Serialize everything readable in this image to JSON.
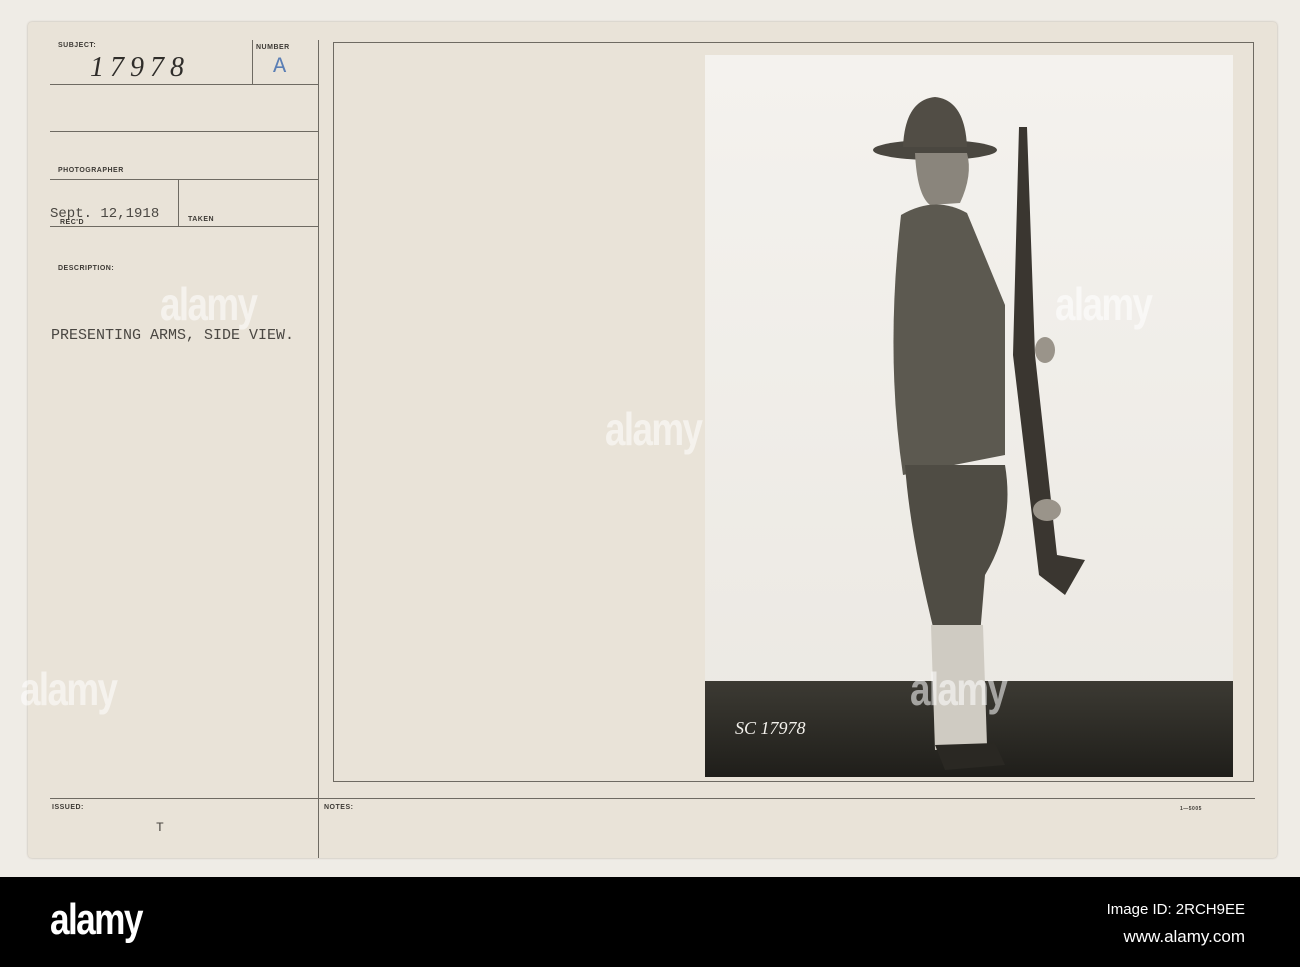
{
  "card": {
    "subject_label": "SUBJECT:",
    "subject_value": "17978",
    "number_label": "NUMBER",
    "number_value": "A",
    "photographer_label": "PHOTOGRAPHER",
    "recd_value": "Sept. 12,1918",
    "recd_label": "REC'D",
    "taken_label": "TAKEN",
    "description_label": "DESCRIPTION:",
    "description_value": "PRESENTING ARMS, SIDE VIEW.",
    "issued_label": "ISSUED:",
    "issued_value": "T",
    "notes_label": "NOTES:",
    "form_number": "1—5005"
  },
  "photo": {
    "negative_mark": "SC 17978"
  },
  "watermark": {
    "text": "alamy"
  },
  "footer": {
    "logo": "alamy",
    "image_id": "Image ID: 2RCH9EE",
    "url": "www.alamy.com"
  }
}
